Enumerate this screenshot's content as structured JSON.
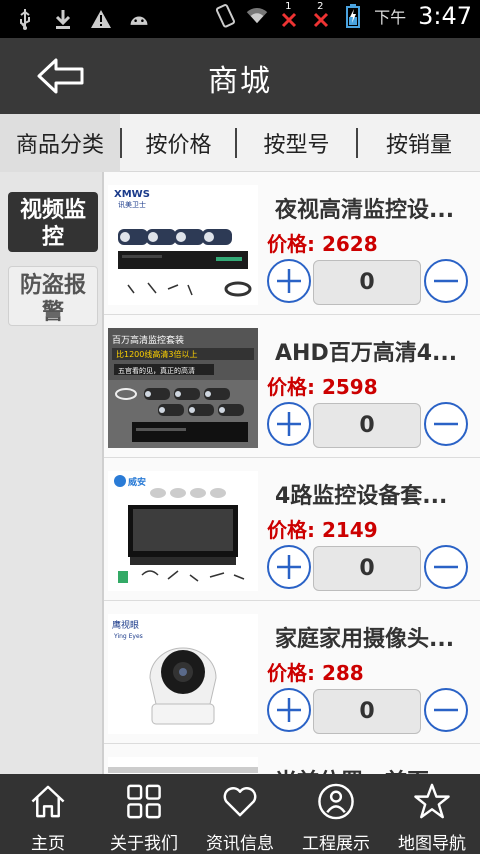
{
  "status_bar": {
    "ampm": "下午",
    "time": "3:47",
    "sim1": "1",
    "sim2": "2"
  },
  "header": {
    "title": "商城"
  },
  "tabs": [
    {
      "label": "商品分类"
    },
    {
      "label": "按价格"
    },
    {
      "label": "按型号"
    },
    {
      "label": "按销量"
    }
  ],
  "sidebar": {
    "items": [
      {
        "label": "视频监控",
        "active": true
      },
      {
        "label": "防盗报警",
        "active": false
      }
    ]
  },
  "products": [
    {
      "name": "夜视高清监控设...",
      "price_label": "价格:",
      "price": "2628",
      "qty": "0",
      "image_text": "XMWS",
      "image_sub": "讯美卫士"
    },
    {
      "name": "AHD百万高清4...",
      "price_label": "价格:",
      "price": "2598",
      "qty": "0",
      "image_text": "百万高清监控套装",
      "image_sub": "比1200线高清3倍以上",
      "image_sub2": "五官看的见，真正的高清"
    },
    {
      "name": "4路监控设备套...",
      "price_label": "价格:",
      "price": "2149",
      "qty": "0",
      "image_text": "威安"
    },
    {
      "name": "家庭家用摄像头...",
      "price_label": "价格:",
      "price": "288",
      "qty": "0",
      "image_text": "鹰视眼",
      "image_sub": "Ying Eyes"
    },
    {
      "name": "当前位置：首页",
      "price_label": "",
      "price": "",
      "qty": ""
    }
  ],
  "bottom_nav": [
    {
      "label": "主页",
      "icon": "home-icon"
    },
    {
      "label": "关于我们",
      "icon": "grid-icon"
    },
    {
      "label": "资讯信息",
      "icon": "heart-icon"
    },
    {
      "label": "工程展示",
      "icon": "user-icon"
    },
    {
      "label": "地图导航",
      "icon": "star-icon"
    }
  ],
  "colors": {
    "accent": "#2a62c6",
    "price": "#cc0000",
    "header_bg": "#393939",
    "nav_bg": "#333333"
  }
}
